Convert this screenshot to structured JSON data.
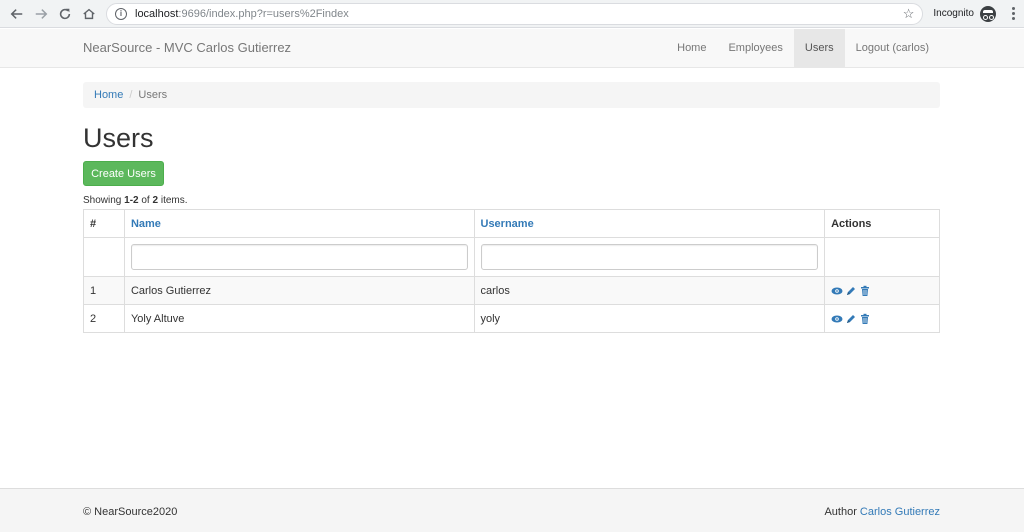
{
  "browser": {
    "url_host": "localhost",
    "url_path": ":9696/index.php?r=users%2Findex",
    "incognito_label": "Incognito"
  },
  "navbar": {
    "brand": "NearSource - MVC Carlos Gutierrez",
    "links": [
      {
        "label": "Home"
      },
      {
        "label": "Employees"
      },
      {
        "label": "Users"
      },
      {
        "label": "Logout (carlos)"
      }
    ]
  },
  "breadcrumb": {
    "home": "Home",
    "current": "Users"
  },
  "page": {
    "title": "Users",
    "create_button": "Create Users",
    "summary_prefix": "Showing ",
    "summary_range": "1-2",
    "summary_mid": " of ",
    "summary_total": "2",
    "summary_suffix": " items."
  },
  "table": {
    "headers": {
      "num": "#",
      "name": "Name",
      "username": "Username",
      "actions": "Actions"
    },
    "rows": [
      {
        "num": "1",
        "name": "Carlos Gutierrez",
        "username": "carlos"
      },
      {
        "num": "2",
        "name": "Yoly Altuve",
        "username": "yoly"
      }
    ]
  },
  "footer": {
    "copyright": "© NearSource2020",
    "author_label": "Author ",
    "author_name": "Carlos Gutierrez"
  },
  "colors": {
    "link": "#337ab7",
    "success": "#5cb85c"
  }
}
